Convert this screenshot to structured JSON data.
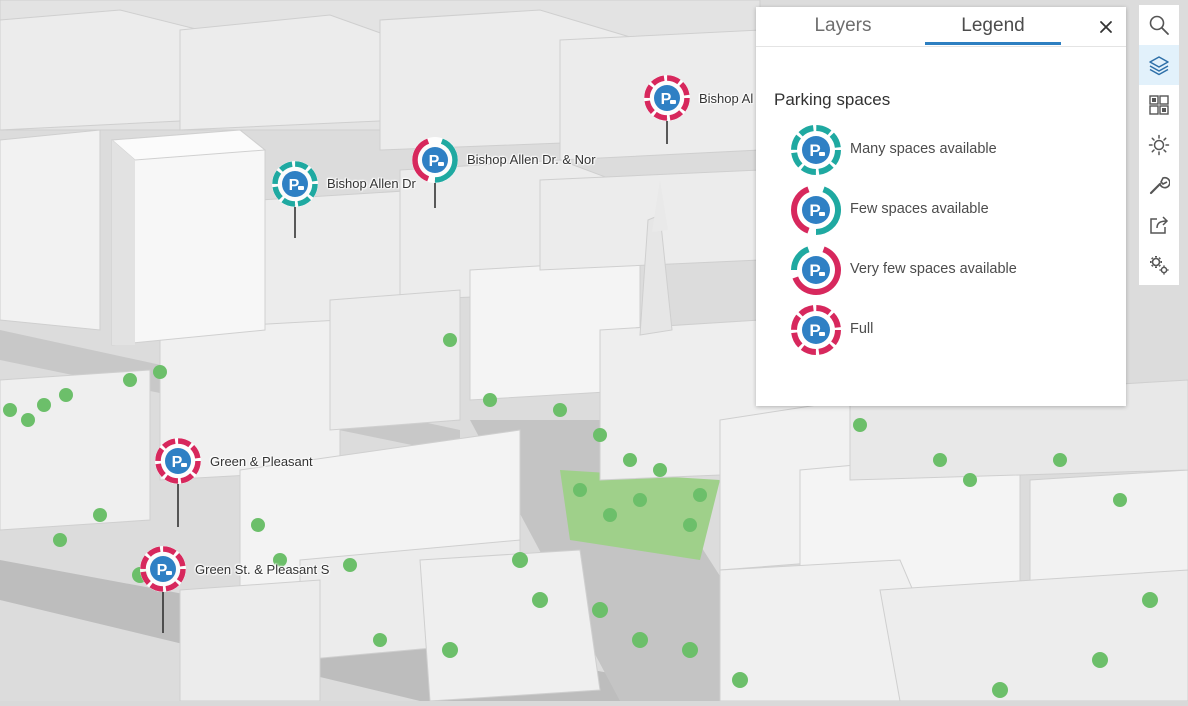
{
  "map": {
    "pins": [
      {
        "label": "Bishop Al",
        "status": "full"
      },
      {
        "label": "Bishop Allen Dr. & Nor",
        "status": "few"
      },
      {
        "label": "Bishop Allen Dr",
        "status": "many"
      },
      {
        "label": "Green & Pleasant",
        "status": "full"
      },
      {
        "label": "Green St. & Pleasant S",
        "status": "full"
      }
    ]
  },
  "panel": {
    "tabs": [
      {
        "label": "Layers",
        "active": false
      },
      {
        "label": "Legend",
        "active": true
      }
    ],
    "close_icon": "close-icon",
    "legend": {
      "title": "Parking spaces",
      "items": [
        {
          "label": "Many spaces available",
          "status": "many"
        },
        {
          "label": "Few spaces available",
          "status": "few"
        },
        {
          "label": "Very few spaces available",
          "status": "veryfew"
        },
        {
          "label": "Full",
          "status": "full"
        }
      ]
    }
  },
  "toolbar": {
    "tools": [
      {
        "icon": "search-icon",
        "active": false
      },
      {
        "icon": "layers-icon",
        "active": true
      },
      {
        "icon": "basemap-gallery-icon",
        "active": false
      },
      {
        "icon": "daylight-icon",
        "active": false
      },
      {
        "icon": "measure-wrench-icon",
        "active": false
      },
      {
        "icon": "share-icon",
        "active": false
      },
      {
        "icon": "settings-gears-icon",
        "active": false
      }
    ]
  },
  "colors": {
    "teal": "#1fa9a1",
    "crimson": "#d7285d",
    "pin_blue": "#2f80c4",
    "accent": "#2d7fc1"
  }
}
